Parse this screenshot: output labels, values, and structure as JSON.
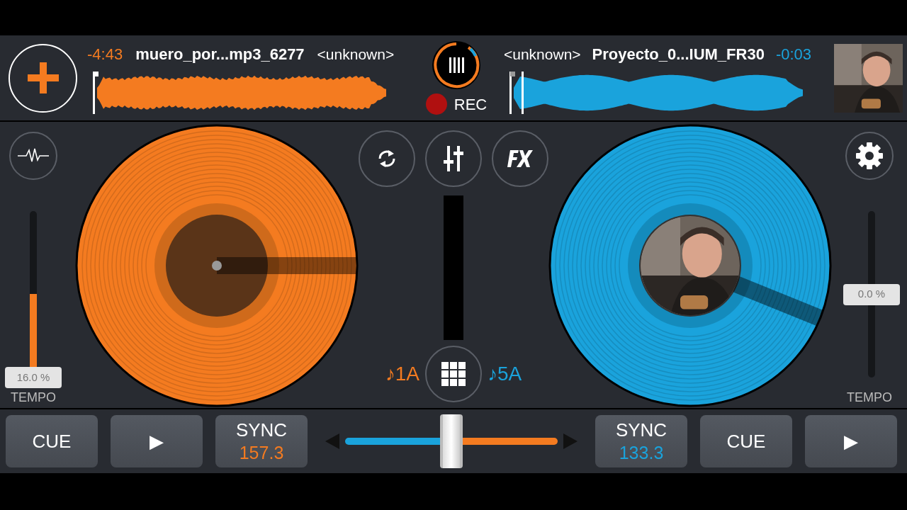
{
  "deck_a": {
    "time": "-4:43",
    "title": "muero_por...mp3_6277",
    "artist": "<unknown>",
    "key": "♪1A",
    "tempo_label": "TEMPO",
    "tempo": {
      "reading": "16.0 %",
      "level": 0.0
    },
    "sync": {
      "label": "SYNC",
      "bpm": "157.3"
    },
    "cue": "CUE",
    "play": "▶"
  },
  "recorder": {
    "label": "REC"
  },
  "deck_b": {
    "artist": "<unknown>",
    "title": "Proyecto_0...IUM_FR30",
    "time": "-0:03",
    "key": "♪5A",
    "tempo_label": "TEMPO",
    "tempo": {
      "reading": "0.0 %",
      "level": 0.5
    },
    "sync": {
      "label": "SYNC",
      "bpm": "133.3"
    },
    "cue": "CUE",
    "play": "▶"
  },
  "crossfader": {
    "level": 0.5
  }
}
